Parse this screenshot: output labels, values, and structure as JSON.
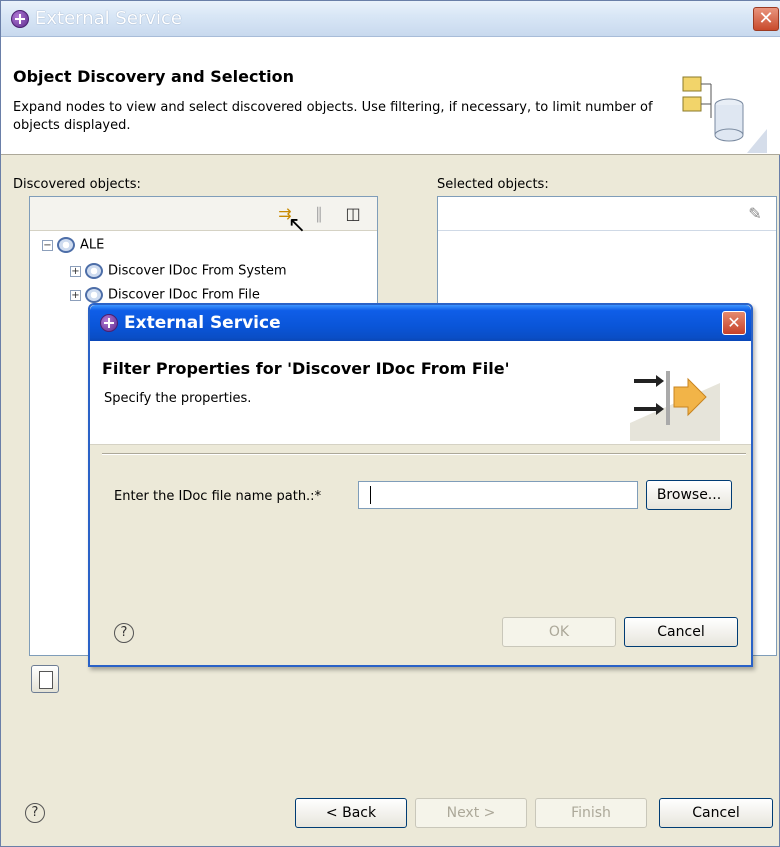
{
  "outer": {
    "title": "External Service",
    "close_glyph": "✕",
    "header_title": "Object Discovery and Selection",
    "header_desc": "Expand nodes to view and select discovered objects.  Use filtering, if necessary, to limit number of objects displayed.",
    "discovered_label": "Discovered objects:",
    "selected_label": "Selected objects:",
    "tree": {
      "root_label": "ALE",
      "child1_label": "Discover IDoc From System",
      "child2_label": "Discover IDoc From File"
    },
    "buttons": {
      "help": "?",
      "back": "< Back",
      "next": "Next >",
      "finish": "Finish",
      "cancel": "Cancel"
    }
  },
  "dialog": {
    "title": "External Service",
    "close_glyph": "✕",
    "heading": "Filter Properties for 'Discover IDoc From File'",
    "desc": "Specify the properties.",
    "field_label": "Enter the IDoc file name path.:*",
    "field_value": "",
    "browse": "Browse...",
    "help": "?",
    "ok": "OK",
    "cancel": "Cancel"
  },
  "colors": {
    "outer_title_gradient": "#c8d9ee",
    "dialog_title_blue": "#0a55d8",
    "face": "#ece9d8"
  }
}
